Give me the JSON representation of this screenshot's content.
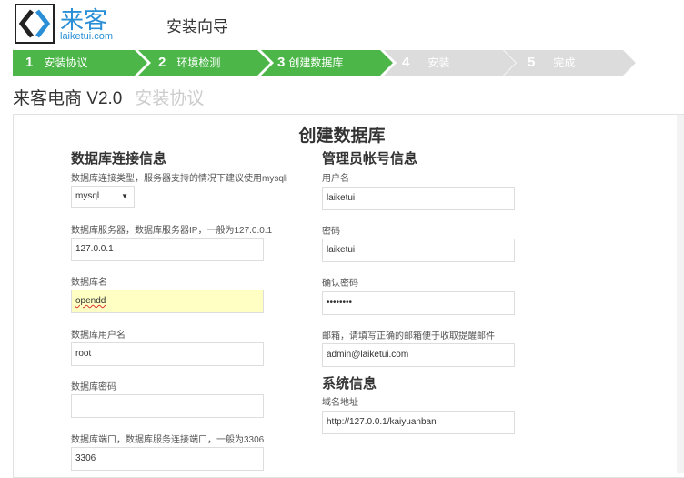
{
  "header": {
    "brand": "来客",
    "brand_sub": "laiketui.com",
    "wizard_title": "安装向导"
  },
  "steps": [
    {
      "num": "1",
      "label": "安装协议",
      "state": "done"
    },
    {
      "num": "2",
      "label": "环境检测",
      "state": "done"
    },
    {
      "num": "3",
      "label": "创建数据库",
      "state": "current"
    },
    {
      "num": "4",
      "label": "安装",
      "state": "todo"
    },
    {
      "num": "5",
      "label": "完成",
      "state": "todo"
    }
  ],
  "page": {
    "title": "来客电商 V2.0",
    "subtitle": "安装协议",
    "panel_title": "创建数据库"
  },
  "db": {
    "heading": "数据库连接信息",
    "type_label": "数据库连接类型，服务器支持的情况下建议使用mysqli",
    "type_value": "mysql",
    "host_label": "数据库服务器，数据库服务器IP，一般为127.0.0.1",
    "host_value": "127.0.0.1",
    "name_label": "数据库名",
    "name_value": "opendd",
    "user_label": "数据库用户名",
    "user_value": "root",
    "pass_label": "数据库密码",
    "pass_value": "",
    "port_label": "数据库端口，数据库服务连接端口，一般为3306",
    "port_value": "3306"
  },
  "admin": {
    "heading": "管理员帐号信息",
    "user_label": "用户名",
    "user_value": "laiketui",
    "pass_label": "密码",
    "pass_value": "laiketui",
    "confirm_label": "确认密码",
    "confirm_value": "••••••••",
    "email_label": "邮箱，请填写正确的邮箱便于收取提醒邮件",
    "email_value": "admin@laiketui.com"
  },
  "system": {
    "heading": "系统信息",
    "domain_label": "域名地址",
    "domain_value": "http://127.0.0.1/kaiyuanban"
  },
  "colors": {
    "accent": "#4cb648",
    "brand": "#2a8fd6",
    "highlight": "#ffffc4"
  }
}
